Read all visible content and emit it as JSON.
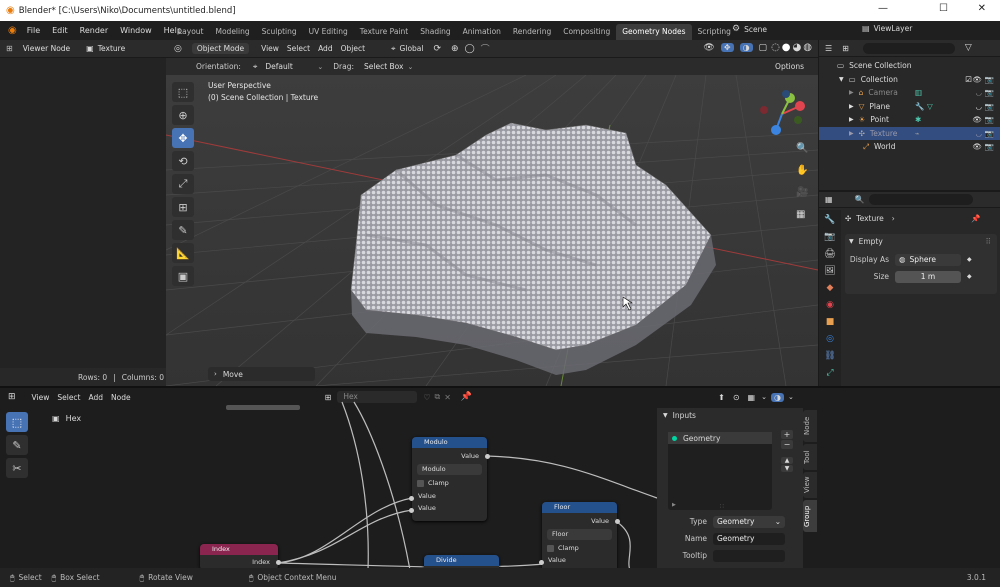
{
  "window": {
    "title": "Blender* [C:\\Users\\Niko\\Documents\\untitled.blend]"
  },
  "menu": [
    "File",
    "Edit",
    "Render",
    "Window",
    "Help"
  ],
  "workspaces": [
    "Layout",
    "Modeling",
    "Sculpting",
    "UV Editing",
    "Texture Paint",
    "Shading",
    "Animation",
    "Rendering",
    "Compositing",
    "Geometry Nodes",
    "Scripting"
  ],
  "scene": "Scene",
  "view_layer": "ViewLayer",
  "left_panel": {
    "editor": "Viewer Node",
    "object": "Texture",
    "rows_label": "Rows: 0",
    "columns_label": "Columns: 0"
  },
  "viewport": {
    "mode": "Object Mode",
    "menus": [
      "View",
      "Select",
      "Add",
      "Object"
    ],
    "transform": "Global",
    "orientation_label": "Orientation:",
    "orientation": "Default",
    "drag_label": "Drag:",
    "drag": "Select Box",
    "options": "Options",
    "perspective": "User Perspective",
    "collection_info": "(0) Scene Collection | Texture",
    "operator": "Move"
  },
  "outliner": {
    "items": [
      {
        "name": "Scene Collection"
      },
      {
        "name": "Collection"
      },
      {
        "name": "Camera"
      },
      {
        "name": "Plane"
      },
      {
        "name": "Point"
      },
      {
        "name": "Texture"
      },
      {
        "name": "World"
      }
    ]
  },
  "properties": {
    "object": "Texture",
    "section": "Empty",
    "display_as_label": "Display As",
    "display_as": "Sphere",
    "size_label": "Size",
    "size": "1 m"
  },
  "node_editor": {
    "menus": [
      "View",
      "Select",
      "Add",
      "Node"
    ],
    "tree": "Hex",
    "breadcrumb": "Hex",
    "nodes": {
      "modulo": {
        "title": "Modulo",
        "out": "Value",
        "op": "Modulo",
        "clamp": "Clamp",
        "in1": "Value",
        "in2": "Value"
      },
      "floor": {
        "title": "Floor",
        "out": "Value",
        "op": "Floor",
        "clamp": "Clamp",
        "in1": "Value"
      },
      "index": {
        "title": "Index",
        "out": "Index"
      },
      "divide": {
        "title": "Divide"
      }
    },
    "inputs_panel": {
      "title": "Inputs",
      "item": "Geometry",
      "type_label": "Type",
      "type": "Geometry",
      "name_label": "Name",
      "name": "Geometry",
      "tooltip_label": "Tooltip"
    },
    "side_tabs": [
      "Node",
      "Tool",
      "View",
      "Group"
    ]
  },
  "statusbar": {
    "select": "Select",
    "box_select": "Box Select",
    "rotate": "Rotate View",
    "context_menu": "Object Context Menu",
    "version": "3.0.1"
  }
}
